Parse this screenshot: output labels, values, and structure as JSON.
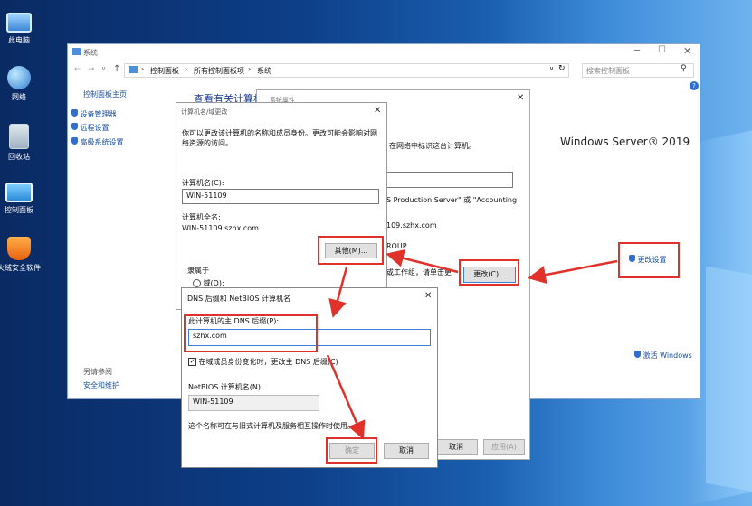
{
  "desktop": {
    "icons": [
      {
        "label": "此电脑"
      },
      {
        "label": "网络"
      },
      {
        "label": "回收站"
      },
      {
        "label": "控制面板"
      },
      {
        "label": "火绒安全软件"
      }
    ]
  },
  "system_window": {
    "title": "系统",
    "breadcrumb": [
      "控制面板",
      "所有控制面板项",
      "系统"
    ],
    "search_placeholder": "搜索控制面板",
    "sidebar": {
      "home": "控制面板主页",
      "items": [
        "设备管理器",
        "远程设置",
        "高级系统设置"
      ],
      "see_also_title": "另请参阅",
      "see_also_items": [
        "安全和维护"
      ]
    },
    "heading": "查看有关计算机的",
    "brand": "Windows Server® 2019",
    "change_settings": "更改设置",
    "activate": "激活 Windows"
  },
  "sys_props": {
    "title": "系统属性",
    "description": "在网络中标识这台计算机。",
    "hint": "S Production Server\" 或 \"Accounting",
    "full_name_partial": "109.szhx.com",
    "workgroup_partial": "ROUP",
    "rename_text": "或工作组，请单击更",
    "change_button": "更改(C)...",
    "cancel_button": "取消",
    "apply_button": "应用(A)"
  },
  "rename_dialog": {
    "title": "计算机名/域更改",
    "description": "你可以更改该计算机的名称和成员身份。更改可能会影响对网络资源的访问。",
    "computer_name_label": "计算机名(C):",
    "computer_name_value": "WIN-51109",
    "full_name_label": "计算机全名:",
    "full_name_value": "WIN-51109.szhx.com",
    "other_button": "其他(M)...",
    "member_of": "隶属于",
    "domain_radio": "域(D):"
  },
  "dns_dialog": {
    "title": "DNS 后缀和 NetBIOS 计算机名",
    "primary_suffix_label": "此计算机的主 DNS 后缀(P):",
    "primary_suffix_value": "szhx.com",
    "checkbox_label": "在域成员身份变化时，更改主 DNS 后缀(C)",
    "netbios_label": "NetBIOS 计算机名(N):",
    "netbios_value": "WIN-51109",
    "note": "这个名称可在与旧式计算机及服务相互操作时使用。",
    "ok_button": "确定",
    "cancel_button": "取消"
  },
  "colors": {
    "highlight": "#e0312a",
    "link": "#1a4fa0"
  }
}
